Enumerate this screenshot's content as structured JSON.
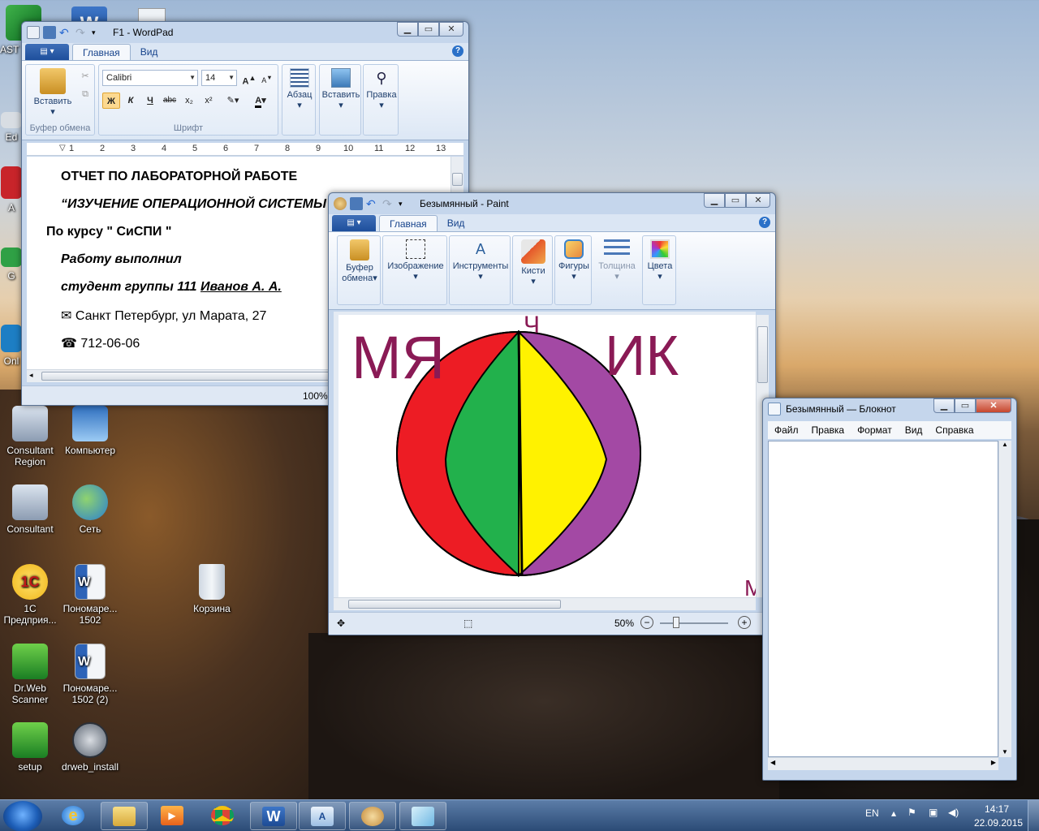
{
  "desktop": {
    "icons": [
      {
        "label": "AST",
        "name": "ast"
      },
      {
        "label": "Ed",
        "name": "ed"
      },
      {
        "label": "A",
        "name": "a"
      },
      {
        "label": "G",
        "name": "g"
      },
      {
        "label": "Onl",
        "name": "onl"
      },
      {
        "label": "Consultant Region",
        "name": "consultant-region"
      },
      {
        "label": "Компьютер",
        "name": "computer"
      },
      {
        "label": "Consultant",
        "name": "consultant"
      },
      {
        "label": "Сеть",
        "name": "network"
      },
      {
        "label": "1С Предприя...",
        "name": "1c"
      },
      {
        "label": "Пономаре... 1502",
        "name": "ponomare-1502"
      },
      {
        "label": "Корзина",
        "name": "recycle-bin"
      },
      {
        "label": "Dr.Web Scanner",
        "name": "drweb-scanner"
      },
      {
        "label": "Пономаре... 1502 (2)",
        "name": "ponomare-1502-2"
      },
      {
        "label": "setup",
        "name": "setup"
      },
      {
        "label": "drweb_install",
        "name": "drweb-install"
      }
    ]
  },
  "wordpad": {
    "title": "F1 - WordPad",
    "tabs": [
      "Главная",
      "Вид"
    ],
    "clipboard": {
      "paste": "Вставить",
      "group": "Буфер обмена"
    },
    "font": {
      "family": "Calibri",
      "size": "14",
      "group": "Шрифт",
      "bold": "Ж",
      "italic": "К",
      "underline": "Ч",
      "strike": "abc",
      "sub": "x₂",
      "sup": "x²"
    },
    "paragraph": "Абзац",
    "insert": "Вставить",
    "editing": "Правка",
    "ruler": [
      "1",
      "2",
      "3",
      "4",
      "5",
      "6",
      "7",
      "8",
      "9",
      "10",
      "11",
      "12",
      "13"
    ],
    "doc": {
      "line1": "ОТЧЕТ ПО ЛАБОРАТОРНОЙ РАБОТЕ",
      "line2": "“ИЗУЧЕНИЕ ОПЕРАЦИОННОЙ СИСТЕМЫ",
      "line3": "По курсу \" СиСПИ \"",
      "line4": "Работу выполнил",
      "line5a": "студент группы 111 ",
      "line5b": "Иванов А. А.",
      "line6": "Санкт Петербург, ул Марата, 27",
      "line7": "712-06-06"
    },
    "zoom": "100%"
  },
  "paint": {
    "title": "Безымянный - Paint",
    "tabs": [
      "Главная",
      "Вид"
    ],
    "groups": {
      "clipboard": "Буфер обмена",
      "image": "Изображение",
      "tools": "Инструменты",
      "brushes": "Кисти",
      "shapes": "Фигуры",
      "thickness": "Толщина",
      "colors": "Цвета"
    },
    "canvas_text": {
      "left": "МЯ",
      "top": "Ч",
      "right": "ИК",
      "edge": "М"
    },
    "zoom": "50%"
  },
  "notepad": {
    "title": "Безымянный — Блокнот",
    "menu": [
      "Файл",
      "Правка",
      "Формат",
      "Вид",
      "Справка"
    ]
  },
  "taskbar": {
    "lang": "EN",
    "time": "14:17",
    "date": "22.09.2015"
  }
}
